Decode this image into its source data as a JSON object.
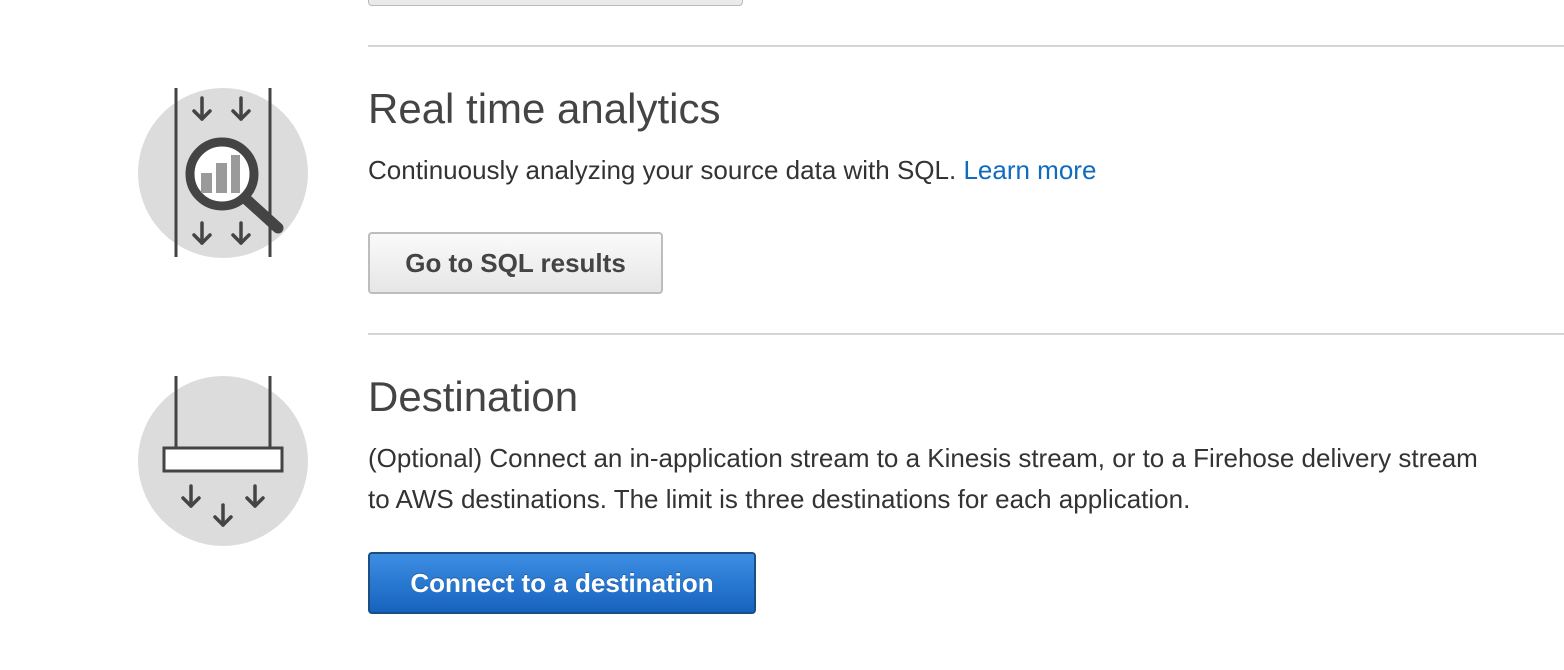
{
  "analytics": {
    "title": "Real time analytics",
    "description": "Continuously analyzing your source data with SQL.",
    "learn_more": "Learn more",
    "button_label": "Go to SQL results",
    "icon": "analytics-magnifier-icon"
  },
  "destination": {
    "title": "Destination",
    "description_line1": "(Optional) Connect an in-application stream to a Kinesis stream, or to a Firehose delivery stream",
    "description_line2": "to AWS destinations. The limit is three destinations for each application.",
    "button_label": "Connect to a destination",
    "icon": "destination-icon"
  },
  "colors": {
    "link": "#0f6bbf",
    "primary_button": "#1663be",
    "text": "#444444",
    "icon_circle": "#dcdcdc",
    "icon_stroke": "#444444"
  }
}
